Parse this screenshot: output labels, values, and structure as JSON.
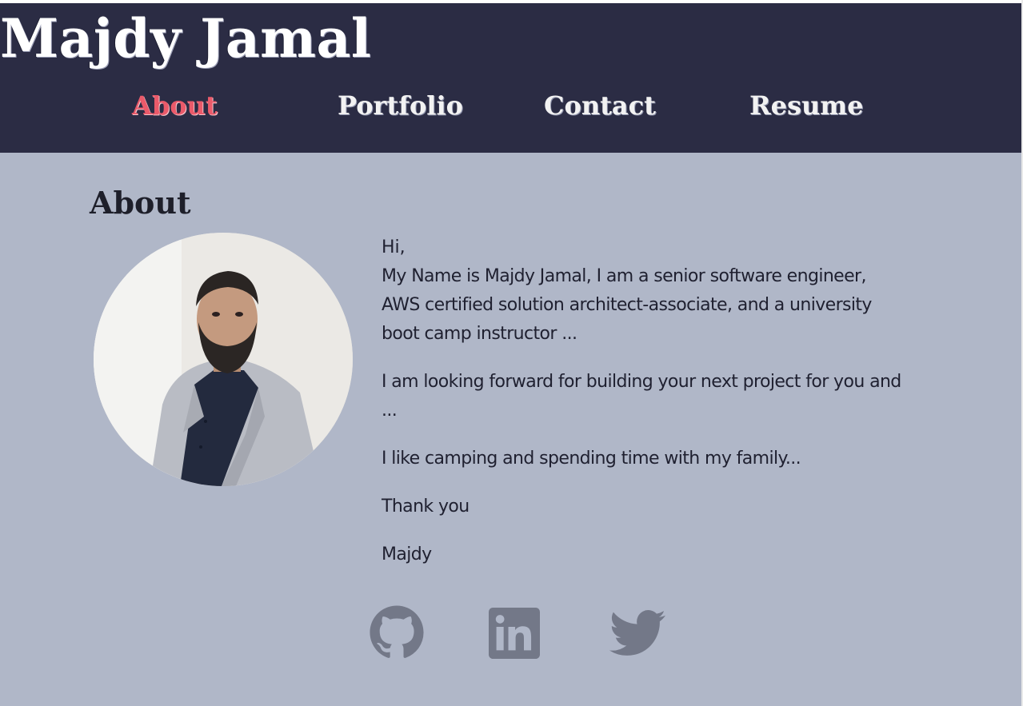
{
  "header": {
    "site_title": "Majdy Jamal",
    "nav": [
      {
        "label": "About",
        "active": true
      },
      {
        "label": "Portfolio",
        "active": false
      },
      {
        "label": "Contact",
        "active": false
      },
      {
        "label": "Resume",
        "active": false
      }
    ]
  },
  "about": {
    "heading": "About",
    "avatar_icon": "profile-photo",
    "paragraphs": [
      "Hi,",
      "My Name is Majdy Jamal, I am a senior software engineer, AWS certified solution architect-associate, and a university boot camp instructor ...",
      "I am looking forward for building your next project for you and ...",
      "I like camping and spending time with my family...",
      "Thank you",
      "Majdy"
    ]
  },
  "socials": [
    {
      "icon": "github-icon"
    },
    {
      "icon": "linkedin-icon"
    },
    {
      "icon": "twitter-icon"
    }
  ],
  "colors": {
    "header_bg": "#2b2c44",
    "page_bg": "#b0b7c8",
    "active_nav": "#ea5a6a",
    "icon_color": "#737888"
  }
}
